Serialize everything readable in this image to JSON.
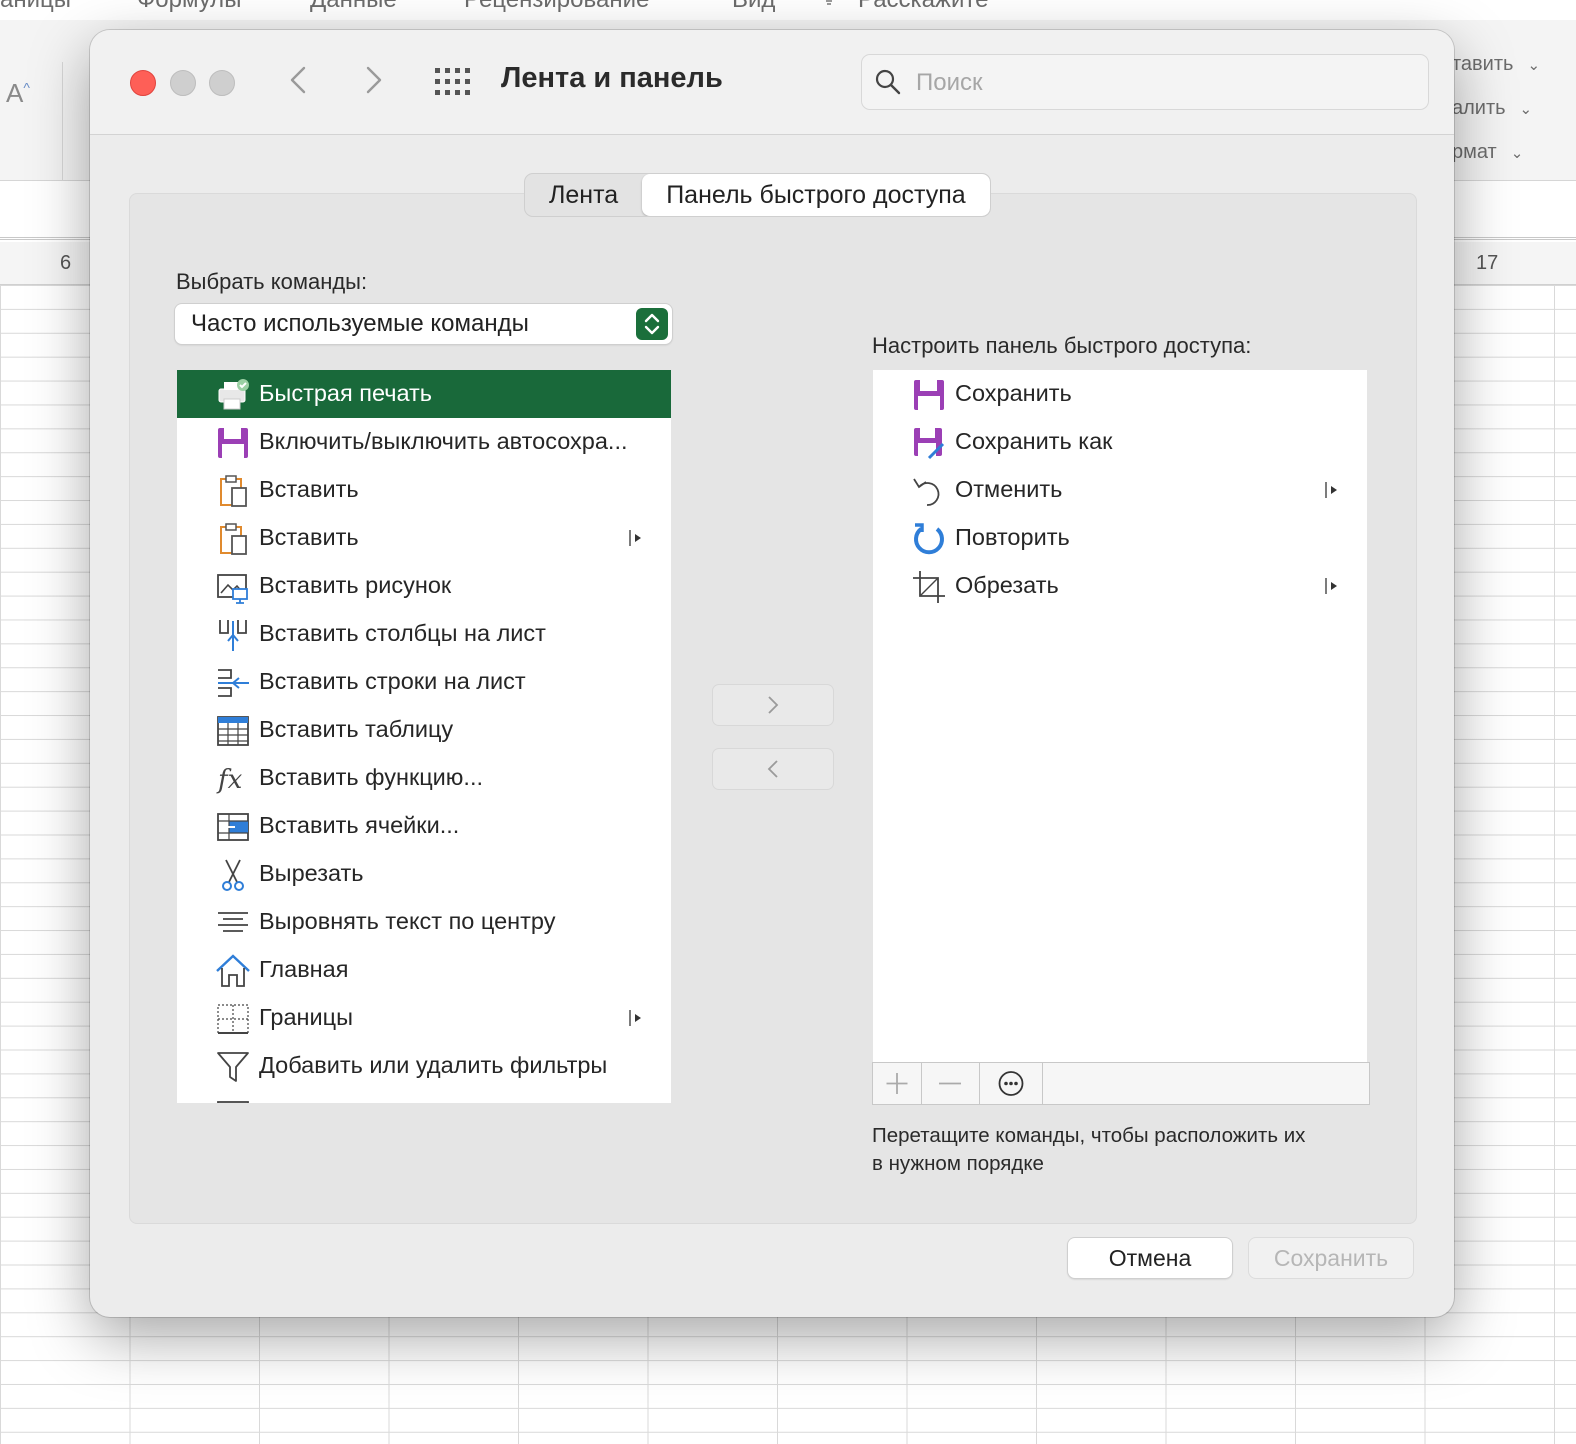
{
  "background": {
    "menu": [
      "аницы",
      "Формулы",
      "Данные",
      "Рецензирование",
      "Вид",
      "Расскажите"
    ],
    "font_button": "A",
    "ribbon_right": [
      "тавить",
      "алить",
      "рмат"
    ],
    "column_headers": [
      "6",
      "17"
    ]
  },
  "window": {
    "title": "Лента и панель",
    "search_placeholder": "Поиск"
  },
  "tabs": [
    {
      "label": "Лента",
      "active": false
    },
    {
      "label": "Панель быстрого доступа",
      "active": true
    }
  ],
  "left": {
    "label": "Выбрать команды:",
    "select_value": "Часто используемые команды",
    "items": [
      {
        "label": "Быстрая печать",
        "icon": "quick-print-icon",
        "selected": true
      },
      {
        "label": "Включить/выключить автосохра...",
        "icon": "autosave-icon"
      },
      {
        "label": "Вставить",
        "icon": "paste-icon"
      },
      {
        "label": "Вставить",
        "icon": "paste-icon",
        "submenu": true
      },
      {
        "label": "Вставить рисунок",
        "icon": "insert-picture-icon"
      },
      {
        "label": "Вставить столбцы на лист",
        "icon": "insert-columns-icon"
      },
      {
        "label": "Вставить строки на лист",
        "icon": "insert-rows-icon"
      },
      {
        "label": "Вставить таблицу",
        "icon": "insert-table-icon"
      },
      {
        "label": "Вставить функцию...",
        "icon": "function-icon"
      },
      {
        "label": "Вставить ячейки...",
        "icon": "insert-cells-icon"
      },
      {
        "label": "Вырезать",
        "icon": "scissors-icon"
      },
      {
        "label": "Выровнять текст по центру",
        "icon": "align-center-icon"
      },
      {
        "label": "Главная",
        "icon": "home-icon"
      },
      {
        "label": "Границы",
        "icon": "borders-icon",
        "submenu": true
      },
      {
        "label": "Добавить или удалить фильтры",
        "icon": "filter-icon"
      }
    ]
  },
  "right": {
    "label": "Настроить панель быстрого доступа:",
    "items": [
      {
        "label": "Сохранить",
        "icon": "save-icon"
      },
      {
        "label": "Сохранить как",
        "icon": "save-as-icon"
      },
      {
        "label": "Отменить",
        "icon": "undo-icon",
        "submenu": true
      },
      {
        "label": "Повторить",
        "icon": "redo-icon"
      },
      {
        "label": "Обрезать",
        "icon": "crop-icon",
        "submenu": true
      }
    ],
    "hint": [
      "Перетащите команды, чтобы расположить их",
      "в нужном порядке"
    ]
  },
  "buttons": {
    "cancel": "Отмена",
    "save": "Сохранить"
  },
  "colors": {
    "accent_green": "#19693a",
    "close_red": "#fe5f57",
    "save_purple": "#9b3fb5",
    "icon_blue": "#2f7ed8"
  }
}
